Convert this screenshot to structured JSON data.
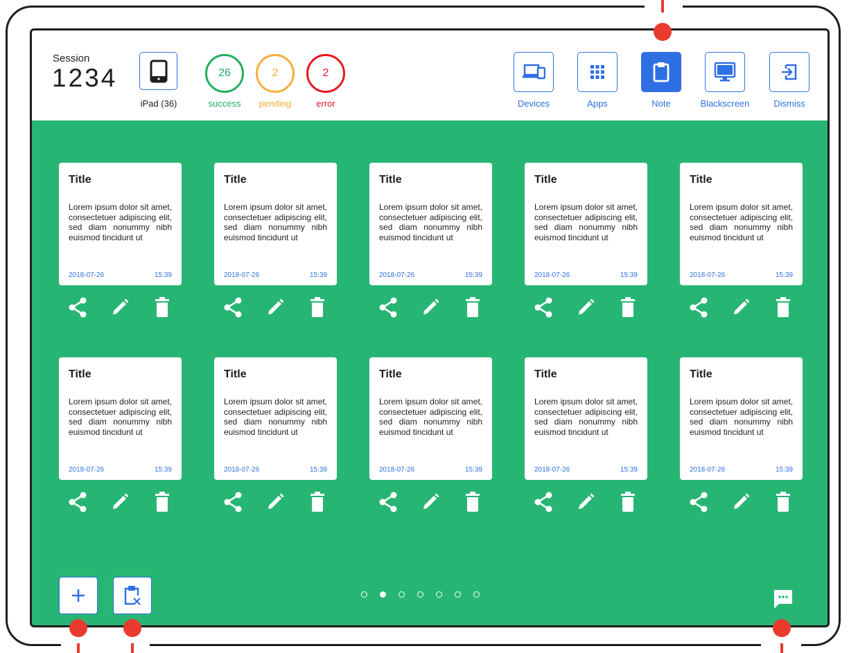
{
  "session": {
    "label": "Session",
    "number": "1234"
  },
  "device": {
    "icon": "ipad-icon",
    "label": "iPad (36)"
  },
  "stats": [
    {
      "value": "26",
      "label": "success",
      "color": "#20ad5e"
    },
    {
      "value": "2",
      "label": "pending",
      "color": "#f6ad3b"
    },
    {
      "value": "2",
      "label": "error",
      "color": "#e8161e"
    }
  ],
  "toolbar": [
    {
      "label": "Devices",
      "icon": "devices-icon",
      "active": false
    },
    {
      "label": "Apps",
      "icon": "apps-grid-icon",
      "active": false
    },
    {
      "label": "Note",
      "icon": "clipboard-icon",
      "active": true
    },
    {
      "label": "Blackscreen",
      "icon": "monitor-icon",
      "active": false
    },
    {
      "label": "Dismiss",
      "icon": "exit-icon",
      "active": false
    }
  ],
  "notes": [
    {
      "title": "Title",
      "body": "Lorem ipsum dolor sit amet, consectetuer adipiscing elit, sed diam nonummy nibh euismod tincidunt ut",
      "date": "2018-07-26",
      "time": "15:39"
    },
    {
      "title": "Title",
      "body": "Lorem ipsum dolor sit amet, consectetuer adipiscing elit, sed diam nonummy nibh euismod tincidunt ut",
      "date": "2018-07-26",
      "time": "15:39"
    },
    {
      "title": "Title",
      "body": "Lorem ipsum dolor sit amet, consectetuer adipiscing elit, sed diam nonummy nibh euismod tincidunt ut",
      "date": "2018-07-26",
      "time": "15:39"
    },
    {
      "title": "Title",
      "body": "Lorem ipsum dolor sit amet, consectetuer adipiscing elit, sed diam nonummy nibh euismod tincidunt ut",
      "date": "2018-07-26",
      "time": "15:39"
    },
    {
      "title": "Title",
      "body": "Lorem ipsum dolor sit amet, consectetuer adipiscing elit, sed diam nonummy nibh euismod tincidunt ut",
      "date": "2018-07-26",
      "time": "15:39"
    },
    {
      "title": "Title",
      "body": "Lorem ipsum dolor sit amet, consectetuer adipiscing elit, sed diam nonummy nibh euismod tincidunt ut",
      "date": "2018-07-26",
      "time": "15:39"
    },
    {
      "title": "Title",
      "body": "Lorem ipsum dolor sit amet, consectetuer adipiscing elit, sed diam nonummy nibh euismod tincidunt ut",
      "date": "2018-07-26",
      "time": "15:39"
    },
    {
      "title": "Title",
      "body": "Lorem ipsum dolor sit amet, consectetuer adipiscing elit, sed diam nonummy nibh euismod tincidunt ut",
      "date": "2018-07-26",
      "time": "15:39"
    },
    {
      "title": "Title",
      "body": "Lorem ipsum dolor sit amet, consectetuer adipiscing elit, sed diam nonummy nibh euismod tincidunt ut",
      "date": "2018-07-26",
      "time": "15:39"
    },
    {
      "title": "Title",
      "body": "Lorem ipsum dolor sit amet, consectetuer adipiscing elit, sed diam nonummy nibh euismod tincidunt ut",
      "date": "2018-07-26",
      "time": "15:39"
    }
  ],
  "note_actions": [
    "share-icon",
    "edit-icon",
    "delete-icon"
  ],
  "pagination": {
    "total": 7,
    "current": 2
  },
  "bottom_buttons": [
    {
      "icon": "add-icon"
    },
    {
      "icon": "clipboard-clear-icon"
    }
  ],
  "chat": {
    "icon": "chat-icon"
  },
  "colors": {
    "accent": "#2f6fe4",
    "background": "#27b574",
    "callout": "#ea3a2d"
  }
}
